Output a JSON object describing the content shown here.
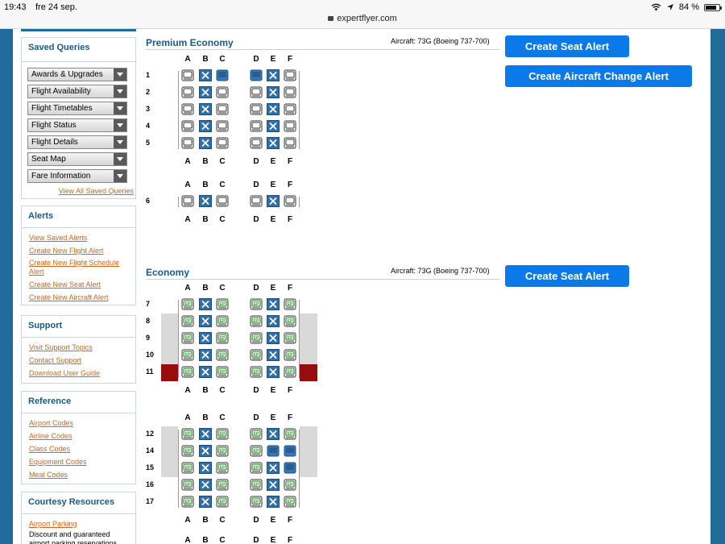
{
  "status": {
    "time": "19:43",
    "date": "fre 24 sep.",
    "url": "expertflyer.com",
    "battery": "84 %",
    "battery_level": 0.84
  },
  "colors": {
    "brand": "#1f6b99",
    "button": "#0b7ae8",
    "link": "#d2661c",
    "exit_row": "#970d0d",
    "occupied": "#3a78b0"
  },
  "sidebar": {
    "saved_queries": {
      "title": "Saved Queries",
      "items": [
        "Awards & Upgrades",
        "Flight Availability",
        "Flight Timetables",
        "Flight Status",
        "Flight Details",
        "Seat Map",
        "Fare Information"
      ],
      "view_all": "View All Saved Queries"
    },
    "alerts": {
      "title": "Alerts",
      "links": [
        "View Saved Alerts",
        "Create New Flight Alert",
        "Create New Flight Schedule Alert",
        "Create New Seat Alert",
        "Create New Aircraft Alert"
      ]
    },
    "support": {
      "title": "Support",
      "links": [
        "Visit Support Topics",
        "Contact Support",
        "Download User Guide"
      ]
    },
    "reference": {
      "title": "Reference",
      "links": [
        "Airport Codes",
        "Airline Codes",
        "Class Codes",
        "Equipment Codes",
        "Meal Codes"
      ]
    },
    "courtesy": {
      "title": "Courtesy Resources",
      "link": "Airport Parking",
      "text": "Discount and guaranteed airport parking reservations"
    }
  },
  "premium": {
    "title": "Premium Economy",
    "aircraft": "Aircraft: 73G (Boeing 737-700)",
    "buttons": {
      "seat_alert": "Create Seat Alert",
      "change_alert": "Create Aircraft Change Alert"
    },
    "columns": [
      "A",
      "B",
      "C",
      "D",
      "E",
      "F"
    ],
    "blocks": [
      {
        "rows": [
          {
            "num": "1",
            "seats": [
              "available",
              "blocked",
              "occupied",
              "occupied",
              "blocked",
              "available"
            ]
          },
          {
            "num": "2",
            "seats": [
              "available",
              "blocked",
              "available",
              "available",
              "blocked",
              "available"
            ]
          },
          {
            "num": "3",
            "seats": [
              "available",
              "blocked",
              "available",
              "available",
              "blocked",
              "available"
            ]
          },
          {
            "num": "4",
            "seats": [
              "available",
              "blocked",
              "available",
              "available",
              "blocked",
              "available"
            ]
          },
          {
            "num": "5",
            "seats": [
              "available",
              "blocked",
              "available",
              "available",
              "blocked",
              "available"
            ]
          }
        ]
      },
      {
        "rows": [
          {
            "num": "6",
            "seats": [
              "available",
              "blocked",
              "available",
              "available",
              "blocked",
              "available"
            ]
          }
        ]
      }
    ]
  },
  "economy": {
    "title": "Economy",
    "aircraft": "Aircraft: 73G (Boeing 737-700)",
    "button": "Create Seat Alert",
    "columns": [
      "A",
      "B",
      "C",
      "D",
      "E",
      "F"
    ],
    "blocks": [
      {
        "rows": [
          {
            "num": "7",
            "seats": [
              "preferred",
              "blocked",
              "preferred",
              "preferred",
              "blocked",
              "preferred"
            ]
          },
          {
            "num": "8",
            "seats": [
              "preferred",
              "blocked",
              "preferred",
              "preferred",
              "blocked",
              "preferred"
            ]
          },
          {
            "num": "9",
            "seats": [
              "preferred",
              "blocked",
              "preferred",
              "preferred",
              "blocked",
              "preferred"
            ]
          },
          {
            "num": "10",
            "seats": [
              "preferred",
              "blocked",
              "preferred",
              "preferred",
              "blocked",
              "preferred"
            ]
          },
          {
            "num": "11",
            "seats": [
              "preferred",
              "blocked",
              "preferred",
              "preferred",
              "blocked",
              "preferred"
            ]
          }
        ]
      },
      {
        "rows": [
          {
            "num": "12",
            "seats": [
              "preferred",
              "blocked",
              "preferred",
              "preferred",
              "blocked",
              "preferred"
            ]
          },
          {
            "num": "14",
            "seats": [
              "preferred",
              "blocked",
              "preferred",
              "preferred",
              "occupied",
              "occupied"
            ]
          },
          {
            "num": "15",
            "seats": [
              "preferred",
              "blocked",
              "preferred",
              "preferred",
              "blocked",
              "occupied"
            ]
          },
          {
            "num": "16",
            "seats": [
              "preferred",
              "blocked",
              "preferred",
              "preferred",
              "blocked",
              "preferred"
            ]
          },
          {
            "num": "17",
            "seats": [
              "preferred",
              "blocked",
              "preferred",
              "preferred",
              "blocked",
              "preferred"
            ]
          }
        ]
      }
    ]
  }
}
